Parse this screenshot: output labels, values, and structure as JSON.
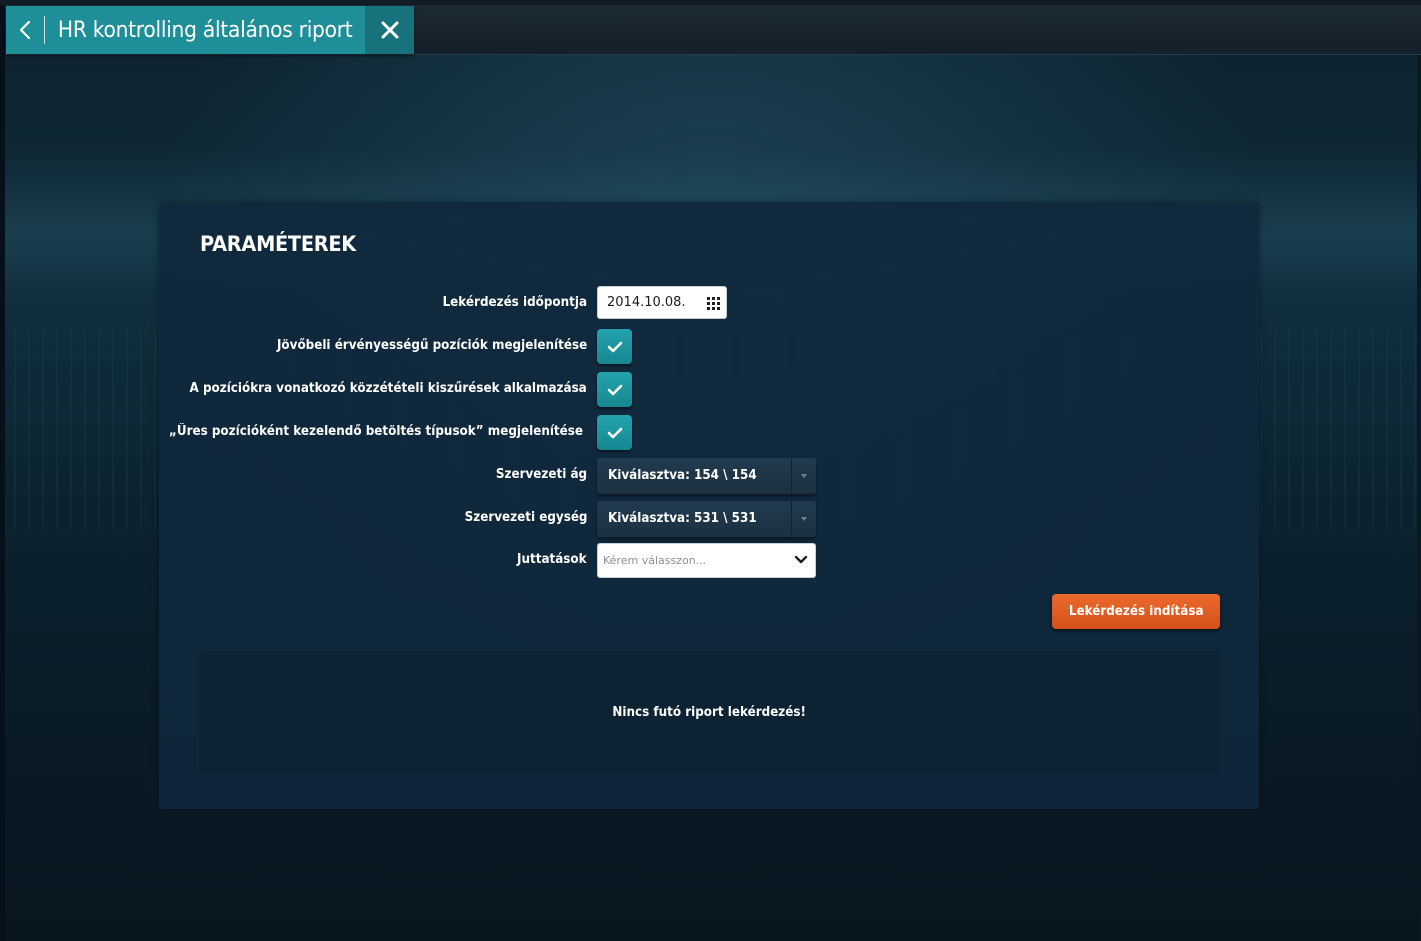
{
  "header": {
    "back_icon": "chevron-left-icon",
    "title": "HR kontrolling általános riport",
    "close_icon": "close-icon"
  },
  "panel": {
    "title": "PARAMÉTEREK",
    "fields": {
      "query_date": {
        "label": "Lekérdezés időpontja",
        "value": "2014.10.08.",
        "icon": "calendar-icon"
      },
      "future_positions": {
        "label": "Jövőbeli érvényességű pozíciók megjelenítése",
        "checked": true
      },
      "publication_filters": {
        "label": "A pozíciókra vonatkozó közzétételi kiszűrések alkalmazása",
        "checked": true
      },
      "empty_position_types": {
        "label": "„Üres pozícióként kezelendő betöltés típusok” megjelenítése",
        "checked": true
      },
      "org_branch": {
        "label": "Szervezeti ág",
        "value": "Kiválasztva: 154 \\ 154"
      },
      "org_unit": {
        "label": "Szervezeti egység",
        "value": "Kiválasztva: 531 \\ 531"
      },
      "benefits": {
        "label": "Juttatások",
        "placeholder": "Kérem válasszon..."
      }
    },
    "run_button": "Lekérdezés indítása",
    "status_message": "Nincs futó riport lekérdezés!"
  },
  "colors": {
    "accent_teal": "#1e8e98",
    "button_orange": "#e0602a",
    "panel_bg": "#10283c"
  }
}
